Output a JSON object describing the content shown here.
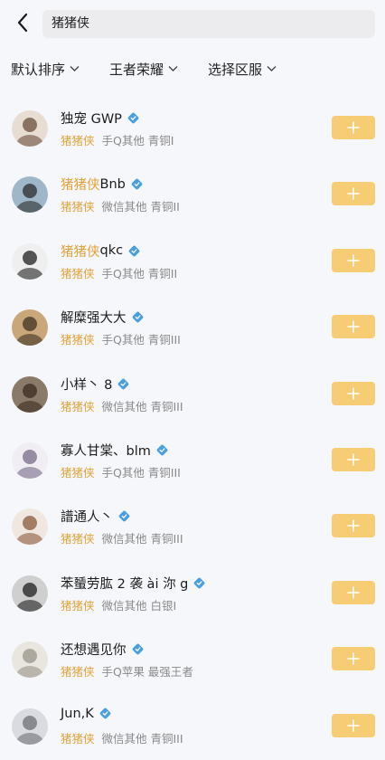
{
  "search": {
    "value": "猪猪侠"
  },
  "filters": [
    {
      "label": "默认排序"
    },
    {
      "label": "王者荣耀"
    },
    {
      "label": "选择区服"
    }
  ],
  "colors": {
    "accent": "#e0a33a",
    "add_button": "#f6cc74",
    "verify": "#4a9fe0"
  },
  "results": [
    {
      "name_hl": "",
      "name_rest": "独宠 GWP",
      "tag": "猪猪侠",
      "meta": "手Q其他 青铜I"
    },
    {
      "name_hl": "猪猪侠",
      "name_rest": " Bnb",
      "tag": "猪猪侠",
      "meta": "微信其他 青铜II"
    },
    {
      "name_hl": "猪猪侠",
      "name_rest": "qkc",
      "tag": "猪猪侠",
      "meta": "手Q其他 青铜II"
    },
    {
      "name_hl": "",
      "name_rest": "解糜强大大",
      "tag": "猪猪侠",
      "meta": "手Q其他 青铜III"
    },
    {
      "name_hl": "",
      "name_rest": "小样丶 8",
      "tag": "猪猪侠",
      "meta": "微信其他 青铜III"
    },
    {
      "name_hl": "",
      "name_rest": "寡人甘棠、blm",
      "tag": "猪猪侠",
      "meta": "手Q其他 青铜III"
    },
    {
      "name_hl": "",
      "name_rest": "譜通人丶",
      "tag": "猪猪侠",
      "meta": "微信其他 青铜III"
    },
    {
      "name_hl": "",
      "name_rest": "苯蜑劳肱 2 袭 ài 沵 g",
      "tag": "猪猪侠",
      "meta": "微信其他 白银I"
    },
    {
      "name_hl": "",
      "name_rest": "还想遇见你",
      "tag": "猪猪侠",
      "meta": "手Q苹果 最强王者"
    },
    {
      "name_hl": "",
      "name_rest": "Jun,K",
      "tag": "猪猪侠",
      "meta": "微信其他 青铜III"
    }
  ]
}
